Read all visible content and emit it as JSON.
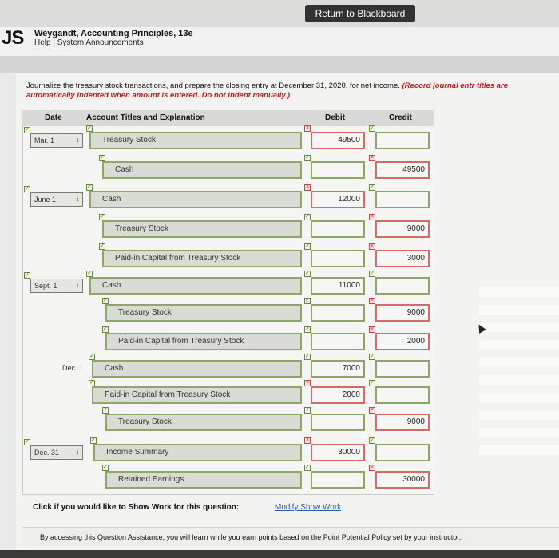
{
  "topbar": {
    "return_label": "Return to Blackboard"
  },
  "header": {
    "logo": "JS",
    "book_title": "Weygandt, Accounting Principles, 13e",
    "help": "Help",
    "separator": "|",
    "announcements": "System Announcements"
  },
  "instructions": {
    "main": "Journalize the treasury stock transactions, and prepare the closing entry at December 31, 2020, for net income. ",
    "red": "(Record journal entr titles are automatically indented when amount is entered. Do not indent manually.)"
  },
  "table": {
    "headers": {
      "date": "Date",
      "account": "Account Titles and Explanation",
      "debit": "Debit",
      "credit": "Credit"
    },
    "rows": [
      {
        "date": "Mar. 1",
        "account": "Treasury Stock",
        "debit": "49500",
        "credit": ""
      },
      {
        "date": "",
        "account": "Cash",
        "debit": "",
        "credit": "49500"
      },
      {
        "date": "June 1",
        "account": "Cash",
        "debit": "12000",
        "credit": ""
      },
      {
        "date": "",
        "account": "Treasury Stock",
        "debit": "",
        "credit": "9000"
      },
      {
        "date": "",
        "account": "Paid-in Capital from Treasury Stock",
        "debit": "",
        "credit": "3000"
      },
      {
        "date": "Sept. 1",
        "account": "Cash",
        "debit": "11000",
        "credit": ""
      },
      {
        "date": "",
        "account": "Treasury Stock",
        "debit": "",
        "credit": "9000"
      },
      {
        "date": "",
        "account": "Paid-in Capital from Treasury Stock",
        "debit": "",
        "credit": "2000"
      },
      {
        "date": "Dec. 1",
        "account": "Cash",
        "debit": "7000",
        "credit": ""
      },
      {
        "date": "",
        "account": "Paid-in Capital from Treasury Stock",
        "debit": "2000",
        "credit": ""
      },
      {
        "date": "",
        "account": "Treasury Stock",
        "debit": "",
        "credit": "9000"
      },
      {
        "date": "Dec. 31",
        "account": "Income Summary",
        "debit": "30000",
        "credit": ""
      },
      {
        "date": "",
        "account": "Retained Earnings",
        "debit": "",
        "credit": "30000"
      }
    ]
  },
  "show_work": {
    "label": "Click if you would like to Show Work for this question:",
    "link": "Modify Show Work"
  },
  "footer": {
    "text": "By accessing this Question Assistance, you will learn while you earn points based on the Point Potential Policy set by your instructor."
  },
  "icons": {
    "correct": "check-icon",
    "incorrect": "x-icon",
    "dropdown": "stepper-icon"
  },
  "colors": {
    "correct": "#8fa56a",
    "incorrect": "#d46a6a",
    "link": "#2a5aa0",
    "instruction_red": "#c4161c"
  }
}
